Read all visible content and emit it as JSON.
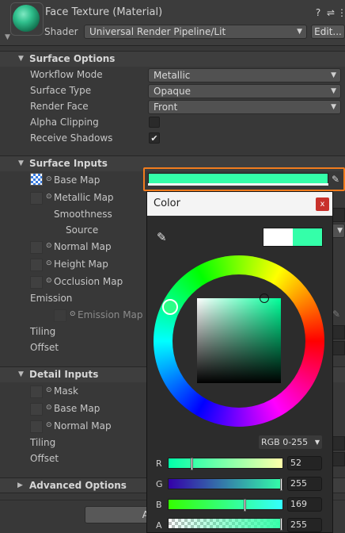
{
  "header": {
    "title": "Face Texture (Material)",
    "shader_label": "Shader",
    "shader_value": "Universal Render Pipeline/Lit",
    "edit_label": "Edit...",
    "icons": [
      "help-icon",
      "presets-icon",
      "more-icon"
    ]
  },
  "surface_options": {
    "title": "Surface Options",
    "rows": [
      {
        "label": "Workflow Mode",
        "value": "Metallic"
      },
      {
        "label": "Surface Type",
        "value": "Opaque"
      },
      {
        "label": "Render Face",
        "value": "Front"
      },
      {
        "label": "Alpha Clipping",
        "checked": false
      },
      {
        "label": "Receive Shadows",
        "checked": true
      }
    ]
  },
  "surface_inputs": {
    "title": "Surface Inputs",
    "base_map": "Base Map",
    "metallic_map": "Metallic Map",
    "smoothness": "Smoothness",
    "source": "Source",
    "normal_map": "Normal Map",
    "height_map": "Height Map",
    "occlusion_map": "Occlusion Map",
    "emission": "Emission",
    "emission_map": "Emission Map",
    "tiling": "Tiling",
    "offset": "Offset",
    "base_color": "#34ffa9"
  },
  "detail_inputs": {
    "title": "Detail Inputs",
    "mask": "Mask",
    "base_map": "Base Map",
    "normal_map": "Normal Map",
    "tiling": "Tiling",
    "offset": "Offset"
  },
  "advanced": {
    "title": "Advanced Options"
  },
  "footer_button_partial": "A",
  "color_picker": {
    "title": "Color",
    "close": "x",
    "mode": "RGB 0-255",
    "previous_color": "#ffffff",
    "current_color": "#34ffa9",
    "channels": [
      {
        "label": "R",
        "value": "52"
      },
      {
        "label": "G",
        "value": "255"
      },
      {
        "label": "B",
        "value": "169"
      },
      {
        "label": "A",
        "value": "255"
      }
    ],
    "accent_highlight": "#f07b1d"
  }
}
